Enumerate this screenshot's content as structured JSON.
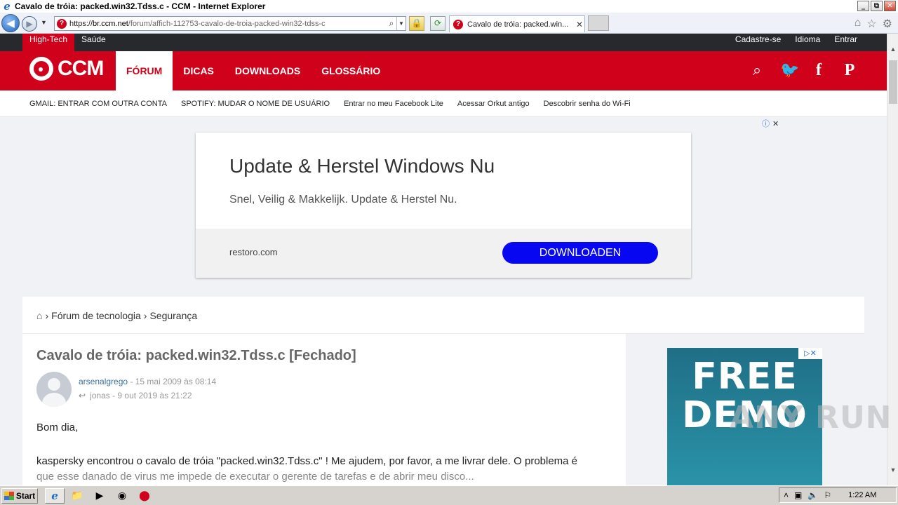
{
  "window": {
    "title": "Cavalo de tróia: packed.win32.Tdss.c - CCM - Internet Explorer",
    "controls": [
      "_",
      "⧉",
      "✕"
    ]
  },
  "browser": {
    "address_url_prefix": "https://",
    "address_url_host": "br.ccm.net",
    "address_url_path": "/forum/affich-112753-cavalo-de-troia-packed-win32-tdss-c",
    "tab_title": "Cavalo de tróia: packed.win...",
    "favicon_letter": "?",
    "icons": [
      "back-icon",
      "forward-icon",
      "search-icon",
      "lock-icon",
      "refresh-icon",
      "home-icon",
      "favorites-icon",
      "tools-icon"
    ]
  },
  "site": {
    "top_tabs": [
      "High-Tech",
      "Saúde"
    ],
    "top_links": [
      "Cadastre-se",
      "Idioma",
      "Entrar"
    ],
    "logo_text": "CCM",
    "main_nav": [
      "FÓRUM",
      "DICAS",
      "DOWNLOADS",
      "GLOSSÁRIO"
    ],
    "brand_color": "#d0021b",
    "quick_links": [
      "GMAIL: ENTRAR COM OUTRA CONTA",
      "SPOTIFY: MUDAR O NOME DE USUÁRIO",
      "Entrar no meu Facebook Lite",
      "Acessar Orkut antigo",
      "Descobrir senha do Wi-Fi"
    ]
  },
  "ad": {
    "headline": "Update & Herstel Windows Nu",
    "subline": "Snel, Veilig & Makkelijk. Update & Herstel Nu.",
    "domain": "restoro.com",
    "button": "DOWNLOADEN",
    "button_color": "#0707f2"
  },
  "breadcrumb": [
    "Fórum de tecnologia",
    "Segurança"
  ],
  "post": {
    "title": "Cavalo de tróia: packed.win32.Tdss.c [Fechado]",
    "author": "arsenalgrego",
    "date": "- 15 mai 2009 às 08:14",
    "last_reply": "jonas - 9 out 2019 às 21:22",
    "greeting": "Bom dia,",
    "body_line1": "kaspersky encontrou o cavalo de tróia \"packed.win32.Tdss.c\" ! Me ajudem, por favor, a me livrar dele. O problema é",
    "body_line2": "que esse danado de virus me impede de executar o gerente de tarefas e de abrir meu disco..."
  },
  "side_ad": {
    "line1": "FREE",
    "line2": "DEMO"
  },
  "watermark": "ANY RUN",
  "taskbar": {
    "start_label": "Start",
    "clock": "1:22 AM"
  }
}
